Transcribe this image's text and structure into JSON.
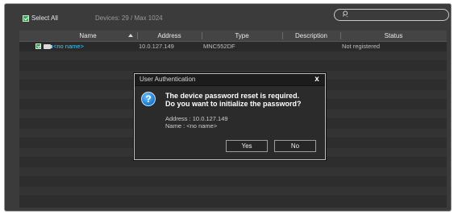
{
  "toolbar": {
    "select_all_label": "Select All",
    "devices_count": "Devices: 29 / Max 1024",
    "search_placeholder": ""
  },
  "table": {
    "columns": [
      "Name",
      "Address",
      "Type",
      "Description",
      "Status"
    ],
    "rows": [
      {
        "name": "<no name>",
        "address": "10.0.127.149",
        "type": "MNC552DF",
        "description": "",
        "status": "Not registered"
      }
    ]
  },
  "dialog": {
    "title": "User Authentication",
    "message_line1": "The device password reset is required.",
    "message_line2": "Do you want to initialize the password?",
    "address": "Address : 10.0.127.149",
    "name": "Name : <no name>",
    "yes_label": "Yes",
    "no_label": "No",
    "close_label": "x"
  },
  "icons": {
    "search": "search-icon",
    "sort": "sort-ascending-icon",
    "question": "question-icon",
    "close": "close-icon",
    "camera": "camera-icon"
  },
  "colors": {
    "name_link": "#43c8ff",
    "check": "#2fa84f"
  }
}
